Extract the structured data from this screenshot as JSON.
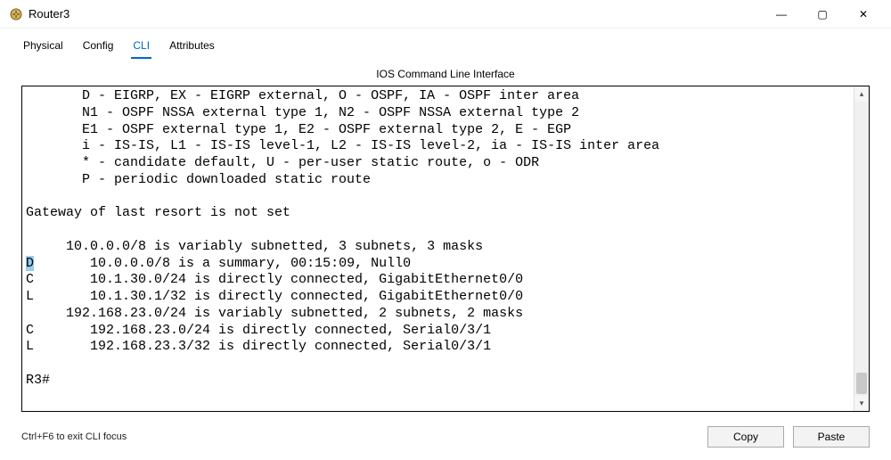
{
  "window": {
    "title": "Router3",
    "minimize_glyph": "—",
    "maximize_glyph": "▢",
    "close_glyph": "✕"
  },
  "tabs": {
    "physical": "Physical",
    "config": "Config",
    "cli": "CLI",
    "attributes": "Attributes",
    "active": "cli"
  },
  "cli": {
    "panel_title": "IOS Command Line Interface",
    "lines": [
      "       D - EIGRP, EX - EIGRP external, O - OSPF, IA - OSPF inter area",
      "       N1 - OSPF NSSA external type 1, N2 - OSPF NSSA external type 2",
      "       E1 - OSPF external type 1, E2 - OSPF external type 2, E - EGP",
      "       i - IS-IS, L1 - IS-IS level-1, L2 - IS-IS level-2, ia - IS-IS inter area",
      "       * - candidate default, U - per-user static route, o - ODR",
      "       P - periodic downloaded static route",
      "",
      "Gateway of last resort is not set",
      "",
      "     10.0.0.0/8 is variably subnetted, 3 subnets, 3 masks"
    ],
    "highlight_line_prefix": "D",
    "highlight_line_rest": "       10.0.0.0/8 is a summary, 00:15:09, Null0",
    "lines_after": [
      "C       10.1.30.0/24 is directly connected, GigabitEthernet0/0",
      "L       10.1.30.1/32 is directly connected, GigabitEthernet0/0",
      "     192.168.23.0/24 is variably subnetted, 2 subnets, 2 masks",
      "C       192.168.23.0/24 is directly connected, Serial0/3/1",
      "L       192.168.23.3/32 is directly connected, Serial0/3/1",
      "",
      "R3#"
    ],
    "scroll_up_glyph": "▴",
    "scroll_down_glyph": "▾"
  },
  "footer": {
    "hint": "Ctrl+F6 to exit CLI focus",
    "copy": "Copy",
    "paste": "Paste"
  }
}
